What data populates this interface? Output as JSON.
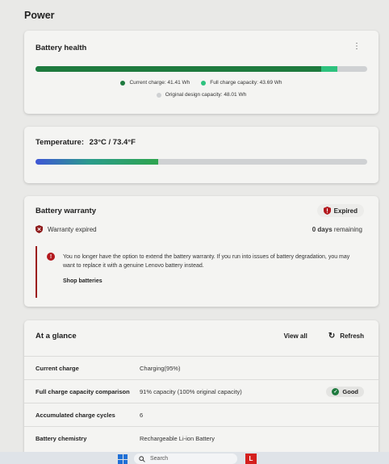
{
  "page": {
    "title": "Power"
  },
  "battery_health": {
    "title": "Battery health",
    "menu_icon": "more-vertical-icon",
    "current_charge_fraction": 0.862,
    "full_capacity_fraction": 0.91,
    "legend": {
      "current": "Current charge: 41.41 Wh",
      "full": "Full charge capacity: 43.69 Wh",
      "design": "Original design capacity: 48.01 Wh"
    },
    "colors": {
      "current": "#1e7a3e",
      "full": "#2ec27e",
      "design": "#cfd1d3"
    }
  },
  "temperature": {
    "label": "Temperature:",
    "value": "23°C / 73.4°F",
    "level_fraction": 0.37
  },
  "warranty": {
    "title": "Battery warranty",
    "badge": "Expired",
    "status": "Warranty expired",
    "remaining_number": "0 days",
    "remaining_suffix": " remaining",
    "notice_icon": "!",
    "notice": "You no longer have the option to extend the battery warranty. If you run into issues of battery degradation, you may want to replace it with a genuine Lenovo battery instead.",
    "link": "Shop batteries"
  },
  "glance": {
    "title": "At a glance",
    "view_all": "View all",
    "refresh": "Refresh",
    "rows": [
      {
        "label": "Current charge",
        "value": "Charging(95%)"
      },
      {
        "label": "Full charge capacity comparison",
        "value": "91% capacity (100% original capacity)",
        "badge": "Good"
      },
      {
        "label": "Accumulated charge cycles",
        "value": "6"
      },
      {
        "label": "Battery chemistry",
        "value": "Rechargeable Li-ion Battery"
      }
    ]
  },
  "taskbar": {
    "search_placeholder": "Search",
    "app_letter": "L"
  }
}
